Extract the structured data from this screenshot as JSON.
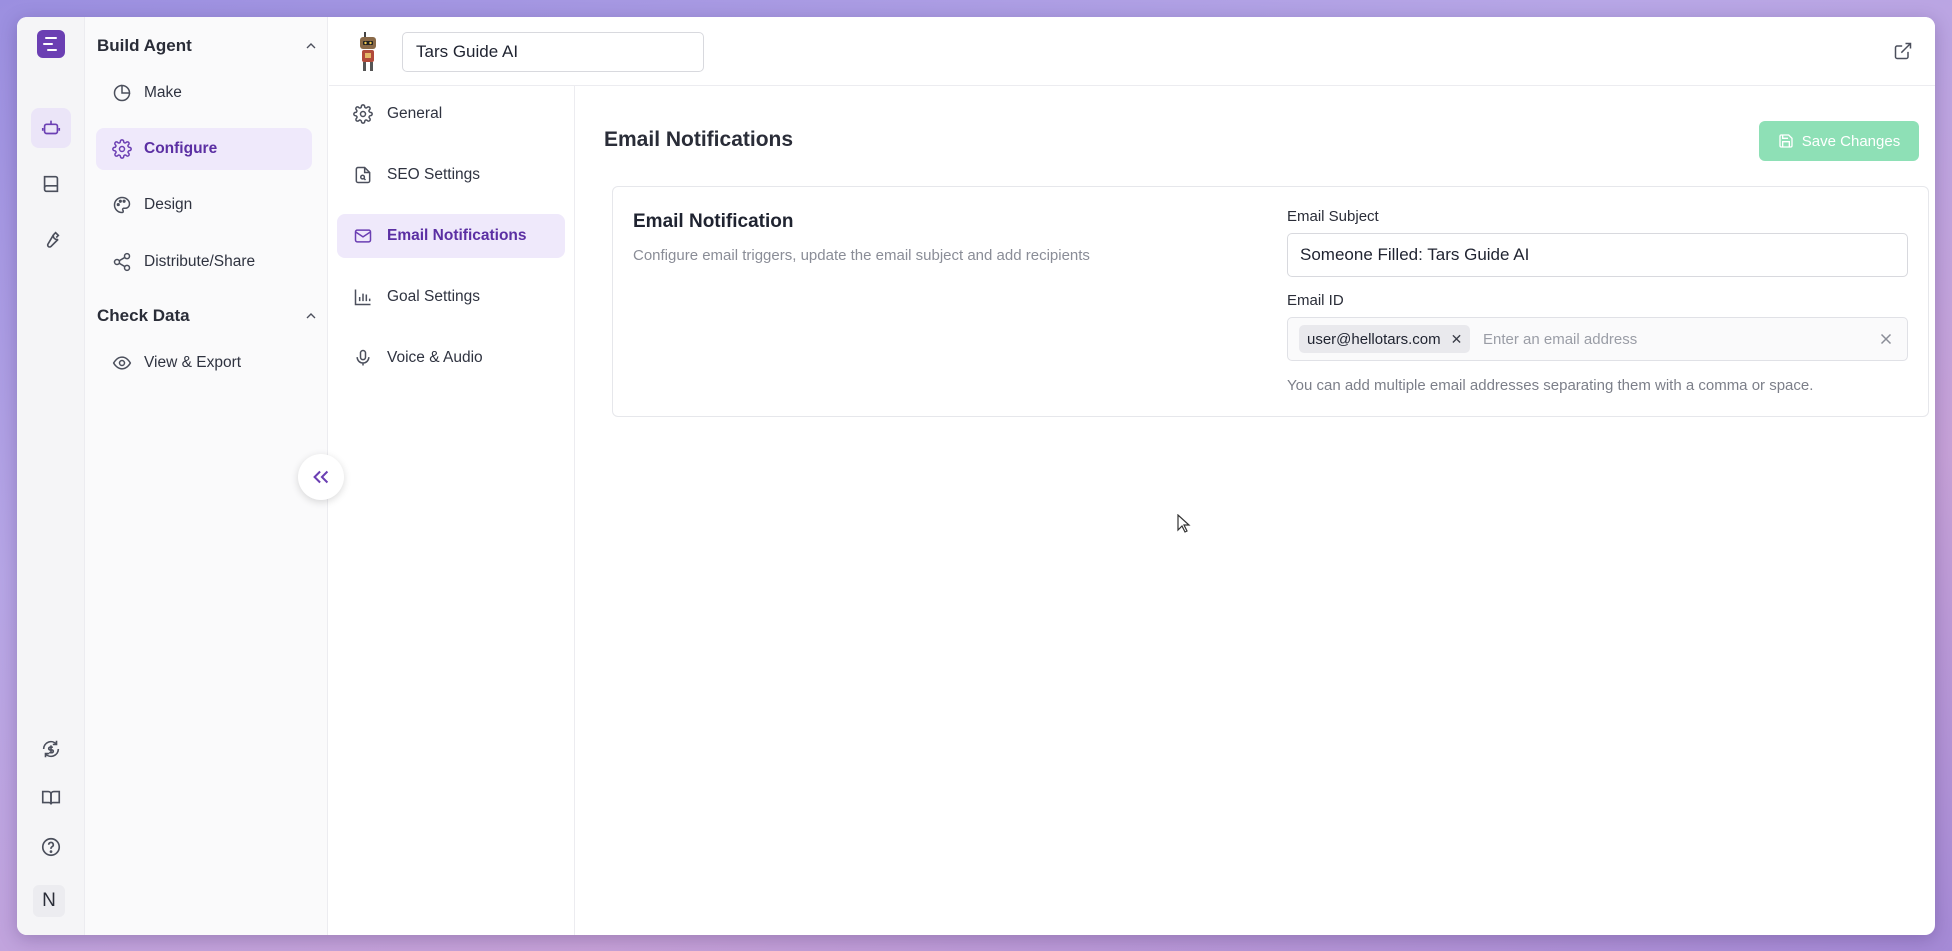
{
  "sidebar": {
    "sections": [
      {
        "title": "Build Agent",
        "items": [
          {
            "label": "Make",
            "icon": "pie-chart-icon"
          },
          {
            "label": "Configure",
            "icon": "gear-icon",
            "active": true
          },
          {
            "label": "Design",
            "icon": "palette-icon"
          },
          {
            "label": "Distribute/Share",
            "icon": "share-icon"
          }
        ]
      },
      {
        "title": "Check Data",
        "items": [
          {
            "label": "View & Export",
            "icon": "eye-icon"
          }
        ]
      }
    ]
  },
  "rail": {
    "icons": [
      "logo-icon",
      "bot-icon",
      "book-icon",
      "wrench-icon",
      "billing-icon",
      "docs-icon",
      "help-icon"
    ],
    "avatar_letter": "N"
  },
  "topbar": {
    "agent_name": "Tars Guide AI"
  },
  "subnav": {
    "items": [
      {
        "label": "General",
        "icon": "gear-icon"
      },
      {
        "label": "SEO Settings",
        "icon": "seo-file-icon"
      },
      {
        "label": "Email Notifications",
        "icon": "mail-icon",
        "active": true
      },
      {
        "label": "Goal Settings",
        "icon": "bar-chart-icon"
      },
      {
        "label": "Voice & Audio",
        "icon": "mic-icon"
      }
    ]
  },
  "main": {
    "title": "Email Notifications",
    "save_label": "Save Changes",
    "card": {
      "title": "Email Notification",
      "description": "Configure email triggers, update the email subject and add recipients",
      "subject_label": "Email Subject",
      "subject_value": "Someone Filled: Tars Guide AI",
      "email_label": "Email ID",
      "email_chips": [
        "user@hellotars.com"
      ],
      "email_placeholder": "Enter an email address",
      "hint": "You can add multiple email addresses separating them with a comma or space."
    }
  },
  "colors": {
    "accent": "#6b3fb3",
    "active_bg": "#efe9fb",
    "save_button": "#8ee0b6"
  }
}
